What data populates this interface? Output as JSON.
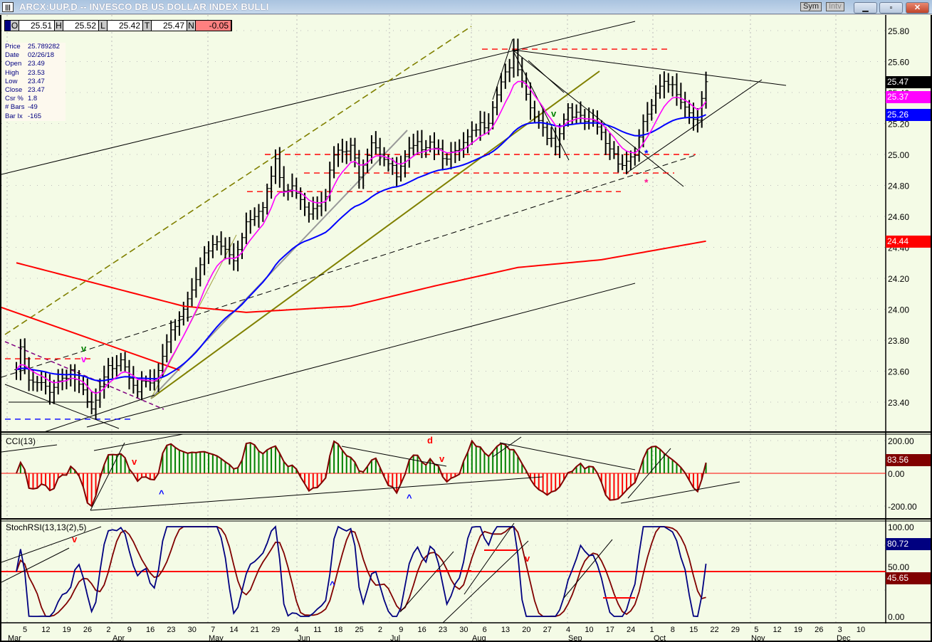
{
  "window": {
    "title": "ARCX:UUP,D -- INVESCO DB US DOLLAR INDEX BULLI",
    "sym_label": "Sym",
    "intv_label": "Intv",
    "minimize": "▁",
    "maximize": "▫",
    "close": "✕"
  },
  "ohlc": {
    "o_label": "O",
    "o": "25.51",
    "h_label": "H",
    "h": "25.52",
    "l_label": "L",
    "l": "25.42",
    "t_label": "T",
    "t": "25.47",
    "n_label": "N",
    "n": "-0.05"
  },
  "info": [
    {
      "k": "Price",
      "v": "25.789282"
    },
    {
      "k": "Date",
      "v": "02/26/18"
    },
    {
      "k": "Open",
      "v": "23.49"
    },
    {
      "k": "High",
      "v": "23.53"
    },
    {
      "k": "Low",
      "v": "23.47"
    },
    {
      "k": "Close",
      "v": "23.47"
    },
    {
      "k": "Csr %",
      "v": "1.8"
    },
    {
      "k": "# Bars",
      "v": "-49"
    },
    {
      "k": "Bar Ix",
      "v": "-165"
    }
  ],
  "tags": {
    "last": "25.47",
    "ema_fast": "25.37",
    "ema_mid": "25.26",
    "ma_slow": "24.44",
    "cci": "83.56",
    "stoch_k": "80.72",
    "stoch_d": "45.65"
  },
  "colors": {
    "bg": "#f4fbe6",
    "ema_fast": "#ff00ff",
    "ema_mid": "#0000ff",
    "ma_slow": "#ff0000",
    "cci_pos": "#008000",
    "cci_neg": "#ff0000",
    "cci_line": "#800000",
    "stoch_k": "#000080",
    "stoch_d": "#800000"
  },
  "annotations": {
    "price": [
      "v",
      "v",
      "v",
      "*",
      "*"
    ],
    "cci": [
      "v",
      "^",
      "d",
      "v",
      "^"
    ],
    "stoch": [
      "v",
      "^",
      "v"
    ]
  },
  "chart_data": [
    {
      "type": "ohlc",
      "title": "ARCX:UUP,D",
      "ylim": [
        23.2,
        25.9
      ],
      "yticks": [
        "25.80",
        "25.60",
        "25.40",
        "25.20",
        "25.00",
        "24.80",
        "24.60",
        "24.40",
        "24.20",
        "24.00",
        "23.80",
        "23.60",
        "23.40"
      ],
      "close_waypoints": [
        [
          0,
          23.61
        ],
        [
          1,
          23.72
        ],
        [
          3,
          23.52
        ],
        [
          8,
          23.49
        ],
        [
          13,
          23.61
        ],
        [
          18,
          23.33
        ],
        [
          22,
          23.61
        ],
        [
          25,
          23.7
        ],
        [
          29,
          23.49
        ],
        [
          33,
          23.52
        ],
        [
          36,
          23.75
        ],
        [
          38,
          23.91
        ],
        [
          41,
          24.07
        ],
        [
          44,
          24.3
        ],
        [
          48,
          24.43
        ],
        [
          52,
          24.32
        ],
        [
          55,
          24.57
        ],
        [
          59,
          24.69
        ],
        [
          62,
          24.94
        ],
        [
          64,
          24.76
        ],
        [
          67,
          24.78
        ],
        [
          70,
          24.64
        ],
        [
          74,
          24.76
        ],
        [
          76,
          24.99
        ],
        [
          80,
          25.03
        ],
        [
          82,
          24.89
        ],
        [
          85,
          25.1
        ],
        [
          88,
          24.99
        ],
        [
          91,
          24.85
        ],
        [
          94,
          25.01
        ],
        [
          99,
          25.1
        ],
        [
          102,
          25.01
        ],
        [
          105,
          24.99
        ],
        [
          110,
          25.15
        ],
        [
          113,
          25.24
        ],
        [
          116,
          25.49
        ],
        [
          119,
          25.63
        ],
        [
          122,
          25.35
        ],
        [
          125,
          25.19
        ],
        [
          129,
          25.08
        ],
        [
          132,
          25.31
        ],
        [
          135,
          25.22
        ],
        [
          139,
          25.17
        ],
        [
          141,
          25.08
        ],
        [
          145,
          24.94
        ],
        [
          148,
          25.01
        ],
        [
          151,
          25.26
        ],
        [
          154,
          25.42
        ],
        [
          157,
          25.47
        ],
        [
          160,
          25.31
        ],
        [
          163,
          25.24
        ],
        [
          165,
          25.47
        ]
      ],
      "ma_slow_waypoints": [
        [
          0,
          24.3
        ],
        [
          20,
          24.16
        ],
        [
          40,
          24.02
        ],
        [
          55,
          23.98
        ],
        [
          80,
          24.02
        ],
        [
          100,
          24.15
        ],
        [
          120,
          24.27
        ],
        [
          140,
          24.32
        ],
        [
          165,
          24.44
        ]
      ],
      "horizontal_levels": [
        25.68,
        25.0,
        24.88,
        24.76,
        23.68,
        23.29
      ]
    },
    {
      "type": "bar",
      "title": "CCI(13)",
      "ylim": [
        -250,
        250
      ],
      "yticks": [
        "200.00",
        "0.00",
        "-200.00"
      ]
    },
    {
      "type": "line",
      "title": "StochRSI(13,13(2),5)",
      "ylim": [
        0,
        100
      ],
      "yticks": [
        "100.00",
        "50.00",
        "0.00"
      ]
    },
    {
      "xaxis": {
        "days": [
          "5",
          "12",
          "19",
          "26",
          "2",
          "9",
          "16",
          "23",
          "30",
          "7",
          "14",
          "21",
          "29",
          "4",
          "11",
          "18",
          "25",
          "2",
          "9",
          "16",
          "23",
          "30",
          "6",
          "13",
          "20",
          "27",
          "4",
          "10",
          "17",
          "24",
          "1",
          "8",
          "15",
          "22",
          "29",
          "5",
          "12",
          "19",
          "26",
          "3",
          "10"
        ],
        "months": [
          "Mar",
          "Apr",
          "May",
          "Jun",
          "Jul",
          "Aug",
          "Sep",
          "Oct",
          "Nov",
          "Dec"
        ]
      }
    }
  ]
}
